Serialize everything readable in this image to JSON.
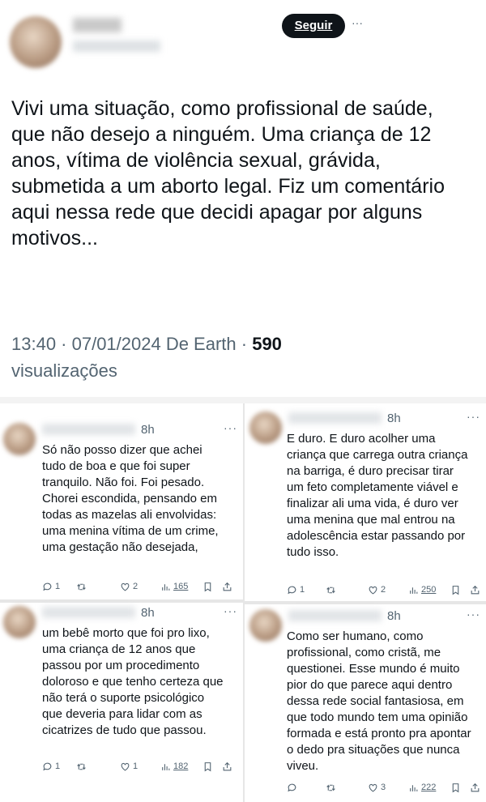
{
  "header": {
    "follow_label": "Seguir"
  },
  "tweet": {
    "text": "Vivi uma situação, como profissional de saúde, que não desejo a ninguém. Uma criança de 12 anos, vítima de violência sexual, grávida, submetida a um aborto legal. Fiz um comentário aqui nessa rede que decidi apagar por alguns motivos...",
    "meta_prefix": "13:40 · 07/01/2024 De Earth · ",
    "views_count": "590",
    "views_label": "visualizações"
  },
  "replies": [
    {
      "time": "8h",
      "more": "···",
      "text": "Só não posso dizer que achei tudo de boa e que foi super tranquilo. Não foi. Foi pesado. Chorei escondida, pensando em todas as mazelas ali envolvidas: uma menina vítima de um crime, uma gestação não desejada,",
      "reply_count": "1",
      "retweet_count": "",
      "like_count": "2",
      "view_count": "165"
    },
    {
      "time": "8h",
      "more": "···",
      "text": "E duro. E duro acolher uma criança que carrega outra criança na barriga, é duro precisar tirar um feto completamente viável e finalizar ali uma vida, é duro ver uma menina que mal entrou na adolescência estar passando por tudo isso.",
      "reply_count": "1",
      "retweet_count": "",
      "like_count": "2",
      "view_count": "250"
    },
    {
      "time": "8h",
      "more": "···",
      "text": "um bebê morto que foi pro lixo, uma criança de 12 anos que passou por um procedimento doloroso e que tenho certeza que não terá o suporte psicológico que deveria para lidar com as cicatrizes de tudo que passou.",
      "reply_count": "1",
      "retweet_count": "",
      "like_count": "1",
      "view_count": "182"
    },
    {
      "time": "8h",
      "more": "···",
      "text": "Como ser humano, como profissional, como cristã, me questionei. Esse mundo é muito pior do que parece aqui dentro dessa rede social fantasiosa, em que todo mundo tem uma opinião formada e está pronto pra apontar o dedo pra situações que nunca viveu.",
      "reply_count": "",
      "retweet_count": "",
      "like_count": "3",
      "view_count": "222"
    }
  ]
}
